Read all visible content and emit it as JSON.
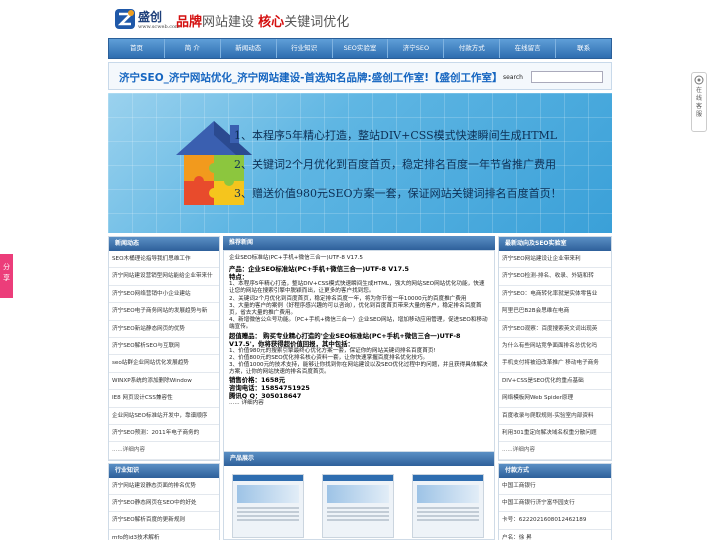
{
  "header": {
    "logo_name": "盛创",
    "logo_url": "www.scweb.com",
    "tagline_a": "品牌",
    "tagline_b": "网站建设",
    "tagline_c": "核心",
    "tagline_d": "关键词优化"
  },
  "nav": {
    "items": [
      "首页",
      "简 介",
      "新闻动态",
      "行业知识",
      "SEO实验室",
      "济宁SEO",
      "付款方式",
      "在线留言",
      "联系"
    ]
  },
  "title_bar": {
    "title": "济宁SEO_济宁网站优化_济宁网站建设-首选知名品牌:盛创工作室!【盛创工作室】",
    "search_label": "search",
    "search_value": ""
  },
  "banner": {
    "lines": [
      "1、本程序5年精心打造，整站DIV+CSS模式快速瞬间生成HTML",
      "2、关键词2个月优化到百度首页，稳定排名百度一年节省推广费用",
      "3、赠送价值980元SEO方案一套，保证网站关键词排名百度首页！"
    ]
  },
  "float_service": {
    "chars": [
      "在",
      "线",
      "客",
      "服"
    ]
  },
  "share": {
    "chars": [
      "分",
      "享"
    ]
  },
  "news": {
    "heading": "新闻动态",
    "items": [
      "SEO木桶理论指导我们思维工作",
      "济宁网站建设营销型网站能给企业带来什",
      "济宁SEO网络营销中小企业建站",
      "济宁SEO电子商务网站的发展趋势与新",
      "济宁SEO新站静态网页的优势",
      "济宁SEO解析SEO与互联网",
      "seo站群企业网站优化发展趋势",
      "WINXP系统的添加删除Window",
      "IE8 网页设计CSS兼容性",
      "企业网站SEO标准站开发中，靠谱顺序",
      "济宁SEO预测：2011年电子商务的"
    ],
    "more": "......详细内容"
  },
  "industry": {
    "heading": "行业知识",
    "items": [
      "济宁网站建设静态页面的排名优势",
      "济宁SEO静态网页在SEO中的好处",
      "济宁SEO解析百度的更新规则",
      "mfo的id3技术解析"
    ]
  },
  "recommend": {
    "heading": "推荐新闻",
    "paragraphs": [
      {
        "style": "n",
        "text": "企业SEO标准站(PC+手机+微信三合一)UTF-8 V17.5"
      },
      {
        "style": "gap",
        "text": ""
      },
      {
        "style": "b",
        "text": "产品：企业SEO标准站(PC+手机+微信三合一)UTF-8 V17.5"
      },
      {
        "style": "b",
        "text": "特点："
      },
      {
        "style": "n",
        "text": "1、本程序5年精心打造，整站DIV+CSS模式快速瞬间生成HTML，强大的网站SEO网站优化功能，快速让您的网站在搜索引擎中脱颖而出，让更多的客户找到您。"
      },
      {
        "style": "n",
        "text": "2、关键词2个月优化到百度首页，稳定排名百度一年，将为你节省一年10000元的百度推广费用"
      },
      {
        "style": "n",
        "text": "3、大量的客户的案例（好程序感兴趣的可以咨询），优化到百度首页带来大量的客户，稳定排名百度首页，省去大量的推广费用。"
      },
      {
        "style": "n",
        "text": "4、新增微信公众号功能。（PC+手机+微信三合一）企业SEO网站，增加移动应用管理，促进SEO和移动端宣传。"
      },
      {
        "style": "b",
        "text": "超值赠品： 购买专业精心打造的'企业SEO标准站(PC+手机+微信三合一)UTF-8 V17.5'，你将获得超价值回报，其中包括："
      },
      {
        "style": "n",
        "text": "1、价值980元的搜索引擎最终心优化方案一套，保证你的网站关键词排名百度首页!"
      },
      {
        "style": "n",
        "text": "2、价值800元的SEO优化排名核心资料一套，让你快速掌握百度排名优化技巧。"
      },
      {
        "style": "n",
        "text": "3、价值1000元的技术支持，能够让你找到你在网站建设以及SEO优化过程中的问题，并且获得具体解决方案，让你的网站快速的排名百度首页。"
      },
      {
        "style": "b",
        "text": "销售价格：1658元"
      },
      {
        "style": "b",
        "text": "咨询电话：15854751925"
      },
      {
        "style": "b",
        "text": "腾讯Q Q：305018647"
      },
      {
        "style": "n",
        "text": "...... 详细内容"
      }
    ]
  },
  "products": {
    "heading": "产品展示"
  },
  "lab": {
    "heading": "最新动向及SEO实验室",
    "items": [
      "济宁SEO网站建设让企业带来利",
      "济宁SEO检测-排名、收录、外链和转",
      "济宁SEO：电商转化率就是实体零售业",
      "阿里巴巴B2B会思维在电商",
      "济宁SEO观察：百度搜索英文词出现英",
      "为什么有些网站竞争面面排名总优化吗",
      "手机支付将被迫改革推广 移动电子商务",
      "DIV+CSS是SEO优化的重点基础",
      "网络模板网Web Spider原理",
      "百度收录与爬取规则-实验室内部资料",
      "利用301重定向解决域名权重分散问题"
    ],
    "more": "......详细内容"
  },
  "payment": {
    "heading": "付款方式",
    "items": [
      "中国工商银行",
      "中国工商银行济宁富华园支行",
      "卡号：6222021608012462189",
      "户名：徐 昇"
    ]
  },
  "colors": {
    "nav_top": "#5f9fd8",
    "nav_bottom": "#2e6db0",
    "title_blue": "#1565c0",
    "brand_red": "#d40f0f",
    "share_pink": "#ec3d7a"
  }
}
